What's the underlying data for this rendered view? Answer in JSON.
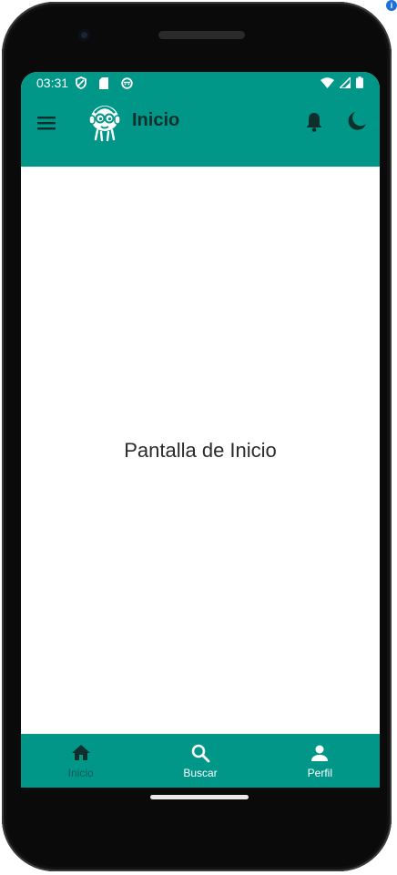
{
  "status_bar": {
    "time": "03:31",
    "left_icons": [
      "shield-icon",
      "sd-card-icon",
      "face-icon"
    ],
    "right_icons": [
      "wifi-icon",
      "signal-icon",
      "battery-icon"
    ]
  },
  "app_bar": {
    "title": "Inicio",
    "icons": [
      "menu-icon",
      "logo-icon",
      "bell-icon",
      "moon-icon"
    ]
  },
  "content": {
    "text": "Pantalla de Inicio"
  },
  "bottom_nav": {
    "items": [
      {
        "label": "Inicio",
        "icon": "home-icon",
        "active": true
      },
      {
        "label": "Buscar",
        "icon": "search-icon",
        "active": false
      },
      {
        "label": "Perfil",
        "icon": "person-icon",
        "active": false
      }
    ]
  },
  "colors": {
    "primary": "#009688",
    "active_nav_label": "#0a5f57",
    "title_text": "#0f2f2c"
  }
}
